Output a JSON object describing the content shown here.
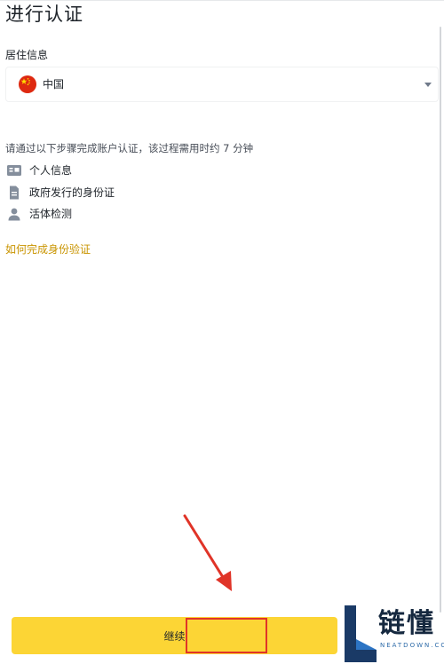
{
  "page": {
    "title": "进行认证"
  },
  "residence": {
    "label": "居住信息",
    "selected_country": "中国"
  },
  "steps_intro": "请通过以下步骤完成账户认证，该过程需用时约 7 分钟",
  "steps": [
    {
      "label": "个人信息",
      "icon": "id-card-icon"
    },
    {
      "label": "政府发行的身份证",
      "icon": "document-icon"
    },
    {
      "label": "活体检测",
      "icon": "person-icon"
    }
  ],
  "help_link": "如何完成身份验证",
  "continue_label": "继续",
  "watermark": {
    "text": "链懂",
    "sub": "NEATDOWN.COM"
  },
  "colors": {
    "accent": "#fcd535",
    "link": "#c99400",
    "annotation": "#e03428"
  }
}
